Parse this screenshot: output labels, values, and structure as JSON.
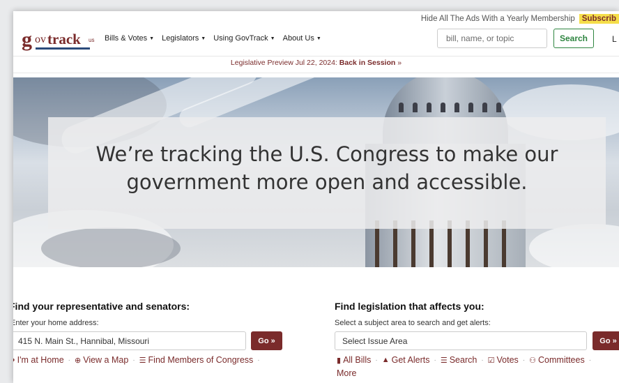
{
  "promo": {
    "hide_ads": "Hide All The Ads With a Yearly Membership",
    "subscribe": "Subscrib"
  },
  "logo": {
    "g": "g",
    "ov": "ov",
    "track": "track",
    "us": "us"
  },
  "nav": [
    {
      "label": "Bills & Votes"
    },
    {
      "label": "Legislators"
    },
    {
      "label": "Using GovTrack"
    },
    {
      "label": "About Us"
    }
  ],
  "search": {
    "placeholder": "bill, name, or topic",
    "button": "Search"
  },
  "login": "L",
  "preview": {
    "prefix": "Legislative Preview Jul 22, 2024: ",
    "link": "Back in Session",
    "suffix": " »"
  },
  "hero": {
    "line1": "We’re tracking the U.S. Congress to make our",
    "line2": "government more open and accessible."
  },
  "find_rep": {
    "title": "Find your representative and senators:",
    "subtitle": "Enter your home address:",
    "address_value": "415 N. Main St., Hannibal, Missouri",
    "go": "Go »",
    "links": [
      "I'm at Home",
      "View a Map",
      "Find Members of Congress"
    ]
  },
  "find_leg": {
    "title": "Find legislation that affects you:",
    "subtitle": "Select a subject area to search and get alerts:",
    "select_value": "Select Issue Area",
    "go": "Go »",
    "links": [
      "All Bills",
      "Get Alerts",
      "Search",
      "Votes",
      "Committees"
    ],
    "more": "More"
  },
  "colors": {
    "brand": "#7a2b2b",
    "search_green": "#2e8540",
    "subscribe_bg": "#f5de4a"
  },
  "icons": [
    "caret-down-icon",
    "map-marker-icon",
    "globe-icon",
    "list-icon",
    "file-icon",
    "bell-icon",
    "check-square-icon",
    "users-icon"
  ]
}
